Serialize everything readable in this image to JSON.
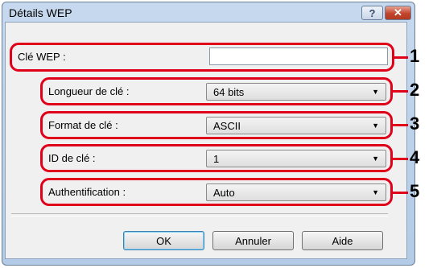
{
  "dialog": {
    "title": "Détails WEP",
    "help_button": "?",
    "close_button": "✕"
  },
  "fields": {
    "wep_key": {
      "label": "Clé WEP :",
      "value": ""
    },
    "key_length": {
      "label": "Longueur de clé :",
      "value": "64 bits"
    },
    "key_format": {
      "label": "Format de clé :",
      "value": "ASCII"
    },
    "key_id": {
      "label": "ID de clé :",
      "value": "1"
    },
    "authentication": {
      "label": "Authentification :",
      "value": "Auto"
    }
  },
  "callouts": [
    "1",
    "2",
    "3",
    "4",
    "5"
  ],
  "buttons": {
    "ok": "OK",
    "cancel": "Annuler",
    "help": "Aide"
  },
  "colors": {
    "callout_frame": "#e0001a",
    "title_bar": "#c7d9ee",
    "client_area": "#f0f0f0"
  }
}
